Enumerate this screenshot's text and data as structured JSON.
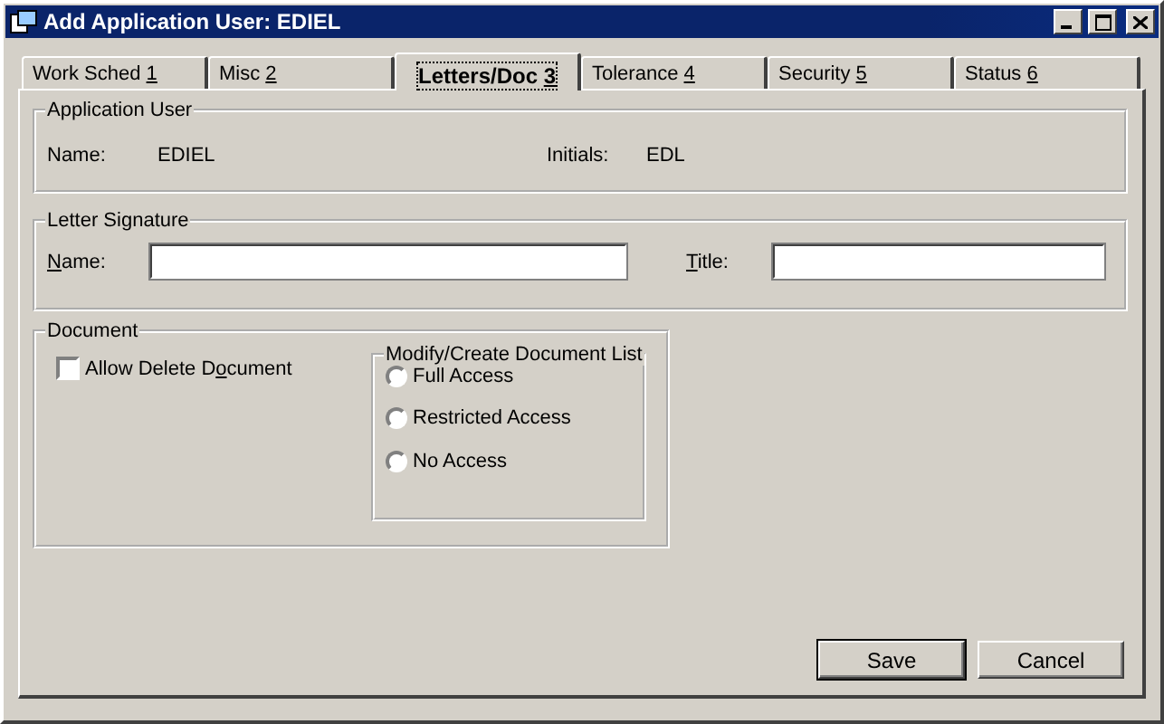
{
  "window": {
    "title": "Add Application User: EDIEL"
  },
  "tabs": [
    {
      "before": "Work Sched ",
      "key": "1",
      "selected": false
    },
    {
      "before": "Misc ",
      "key": "2",
      "selected": false
    },
    {
      "before": "Letters/Doc ",
      "key": "3",
      "selected": true
    },
    {
      "before": "Tolerance ",
      "key": "4",
      "selected": false
    },
    {
      "before": "Security ",
      "key": "5",
      "selected": false
    },
    {
      "before": "Status ",
      "key": "6",
      "selected": false
    }
  ],
  "application_user": {
    "title": "Application User",
    "name_label": "Name:",
    "name_value": "EDIEL",
    "initials_label": "Initials:",
    "initials_value": "EDL"
  },
  "letter_signature": {
    "title": "Letter Signature",
    "name_label": {
      "key": "N",
      "after": "ame:"
    },
    "title_label": {
      "key": "T",
      "after": "itle:"
    }
  },
  "document": {
    "title": "Document",
    "allow_delete": {
      "label": {
        "before": "Allow Delete D",
        "key": "o",
        "after": "cument"
      },
      "checked": false
    },
    "list_access": {
      "title": "Modify/Create Document List",
      "options": [
        {
          "label": "Full Access",
          "selected": false
        },
        {
          "label": "Restricted Access",
          "selected": false
        },
        {
          "label": "No Access",
          "selected": false
        }
      ]
    }
  },
  "buttons": [
    {
      "label": "Save",
      "default": true
    },
    {
      "label": "Cancel",
      "default": false
    }
  ]
}
